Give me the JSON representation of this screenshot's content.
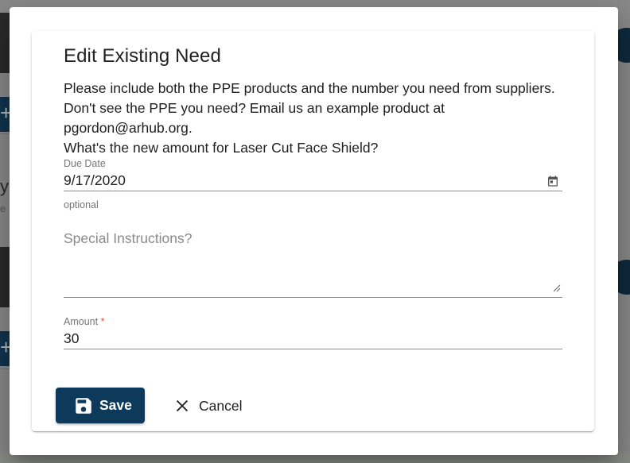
{
  "dialog": {
    "title": "Edit Existing Need",
    "description_lines": [
      "Please include both the PPE products and the number you need from suppliers.",
      "Don't see the PPE you need? Email us an example product at",
      "pgordon@arhub.org.",
      "What's the new amount for Laser Cut Face Shield?"
    ],
    "due_date": {
      "label": "Due Date",
      "value": "9/17/2020",
      "helper": "optional",
      "icon": "calendar-icon"
    },
    "special_instructions": {
      "placeholder": "Special Instructions?",
      "value": ""
    },
    "amount": {
      "label": "Amount",
      "required_mark": "*",
      "value": "30"
    },
    "actions": {
      "save_label": "Save",
      "save_icon": "floppy-disk-icon",
      "cancel_label": "Cancel",
      "cancel_icon": "close-icon"
    }
  },
  "background": {
    "add_glyph": "+",
    "letter": "y",
    "sub_letter": "e"
  },
  "colors": {
    "primary": "#0d3a5b",
    "required": "#f44336",
    "overlay": "#7f7f7f"
  }
}
